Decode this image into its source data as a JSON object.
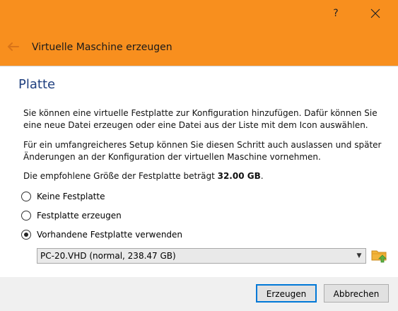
{
  "window": {
    "help_label": "?",
    "title": "Virtuelle Maschine erzeugen"
  },
  "page": {
    "title": "Platte",
    "paragraph1": "Sie können eine virtuelle Festplatte zur Konfiguration hinzufügen. Dafür können Sie eine neue Datei erzeugen oder eine Datei aus der Liste mit dem Icon auswählen.",
    "paragraph2": "Für ein umfangreicheres Setup können Sie diesen Schritt auch auslassen und später Änderungen an der Konfiguration der virtuellen Maschine vornehmen.",
    "recommended_prefix": "Die empfohlene Größe der Festplatte beträgt ",
    "recommended_size": "32.00 GB",
    "recommended_suffix": "."
  },
  "options": [
    {
      "label": "Keine Festplatte",
      "checked": false
    },
    {
      "label": "Festplatte erzeugen",
      "checked": false
    },
    {
      "label": "Vorhandene Festplatte verwenden",
      "checked": true
    }
  ],
  "disk_select": {
    "value": "PC-20.VHD (normal, 238.47 GB)"
  },
  "buttons": {
    "create": "Erzeugen",
    "cancel": "Abbrechen"
  },
  "colors": {
    "titlebar": "#f88f1e",
    "title_text": "#1f3f7f",
    "default_button_border": "#0078d7"
  },
  "icons": {
    "back": "arrow-left-icon",
    "close": "close-icon",
    "folder": "folder-add-icon"
  }
}
